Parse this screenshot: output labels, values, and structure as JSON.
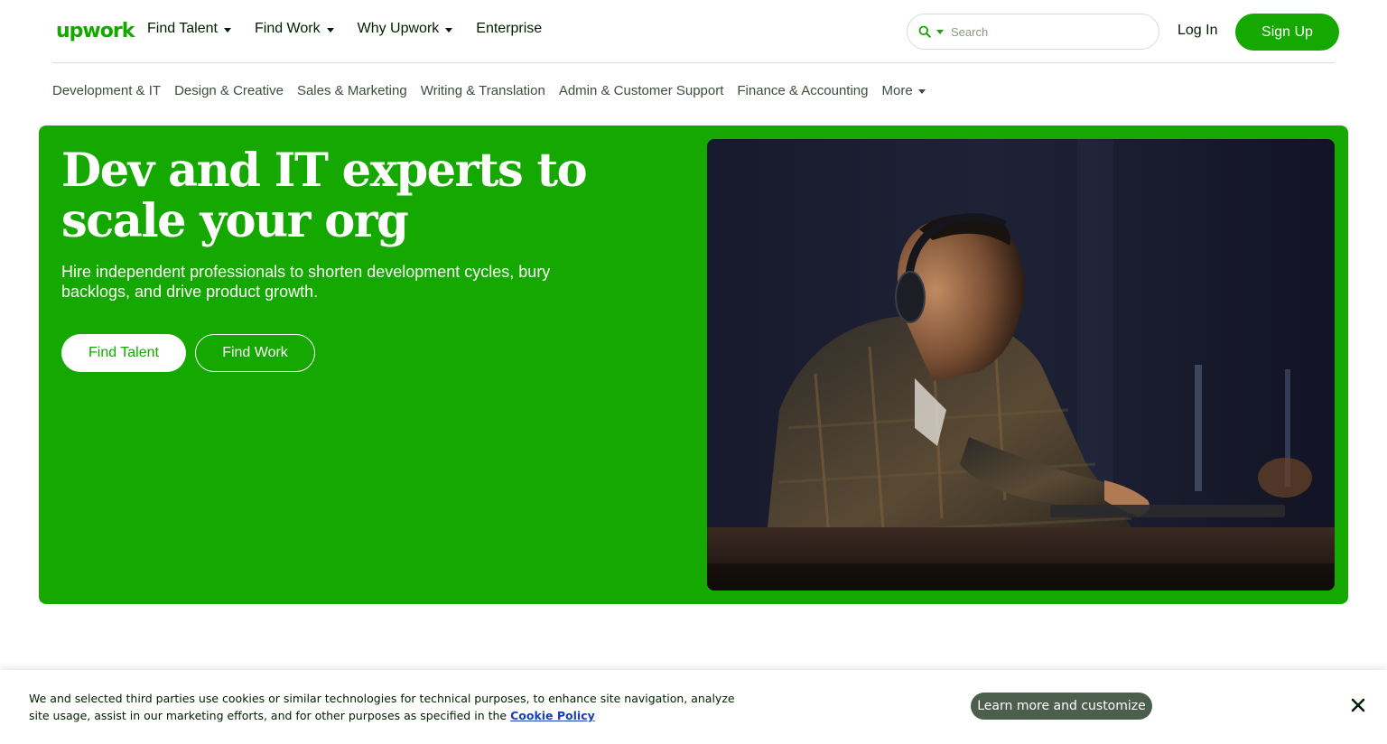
{
  "header": {
    "logo_text": "upwork",
    "nav": [
      {
        "label": "Find Talent",
        "has_dropdown": true
      },
      {
        "label": "Find Work",
        "has_dropdown": true
      },
      {
        "label": "Why Upwork",
        "has_dropdown": true
      },
      {
        "label": "Enterprise",
        "has_dropdown": false
      }
    ],
    "search": {
      "placeholder": "Search",
      "value": ""
    },
    "login_label": "Log In",
    "signup_label": "Sign Up"
  },
  "categories": [
    "Development & IT",
    "Design & Creative",
    "Sales & Marketing",
    "Writing & Translation",
    "Admin & Customer Support",
    "Finance & Accounting",
    "More"
  ],
  "hero": {
    "title": "Dev and IT experts to scale your org",
    "subtitle": "Hire independent professionals to shorten development cycles, bury backlogs, and drive product growth.",
    "primary_cta": "Find Talent",
    "secondary_cta": "Find Work"
  },
  "cookie_banner": {
    "text": "We and selected third parties use cookies or similar technologies for technical purposes, to enhance site navigation, analyze site usage, assist in our marketing efforts, and for other purposes as specified in the",
    "link_label": "Cookie Policy",
    "customize_label": "Learn more and customize"
  },
  "colors": {
    "brand_green": "#14a800",
    "text_dark": "#001e00",
    "cookie_button": "#4c5e4c",
    "link_blue": "#1a3fb8"
  },
  "icons": {
    "search": "search-icon",
    "close": "close-icon",
    "dropdown": "chevron-down-icon"
  }
}
